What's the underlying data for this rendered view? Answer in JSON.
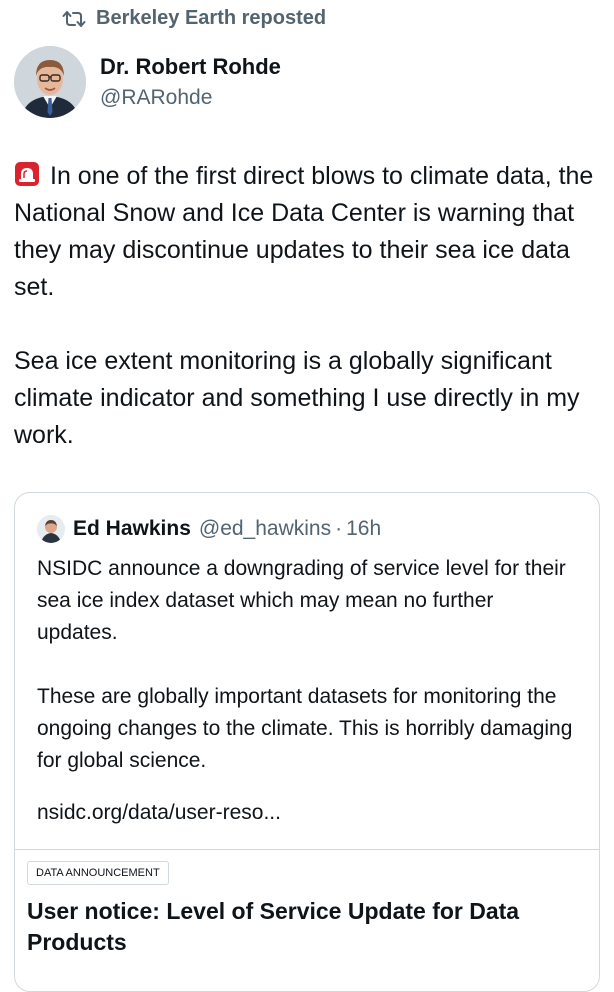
{
  "repost": {
    "icon": "repost-icon",
    "label": "Berkeley Earth reposted"
  },
  "post": {
    "author": {
      "name": "Dr. Robert Rohde",
      "handle": "@RARohde",
      "avatar": "avatar"
    },
    "emoji": "siren-emoji",
    "paragraph1": "In one of the first direct blows to climate data, the National Snow and Ice Data Center is warning that they may discontinue updates to their sea ice data set.",
    "paragraph2": "Sea ice extent monitoring is a globally significant climate indicator and something I use directly in my work."
  },
  "quote": {
    "author": {
      "name": "Ed Hawkins",
      "handle": "@ed_hawkins",
      "separator": "·",
      "time": "16h"
    },
    "paragraph1": "NSIDC announce a downgrading of service level for their sea ice index dataset which may mean no further updates.",
    "paragraph2": "These are globally important datasets for monitoring the ongoing changes to the climate. This is horribly damaging for global science.",
    "link": "nsidc.org/data/user-reso...",
    "link_card": {
      "tag": "DATA ANNOUNCEMENT",
      "title": "User notice: Level of Service Update for Data Products"
    }
  },
  "colors": {
    "text": "#0f1419",
    "secondary": "#536471",
    "border": "#cfd9de",
    "siren_red": "#d9232e"
  }
}
